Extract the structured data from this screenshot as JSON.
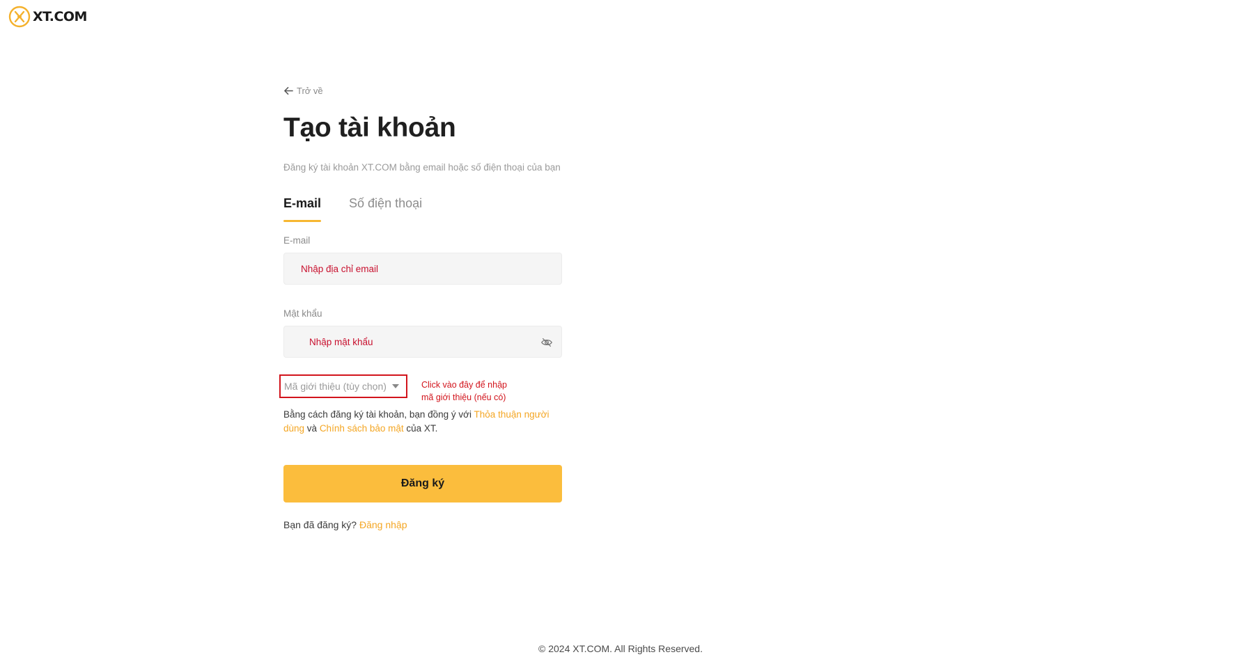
{
  "logo": {
    "text_x": "X",
    "text_rest": "T.COM"
  },
  "back": {
    "label": "Trở về"
  },
  "title": "Tạo tài khoản",
  "subtitle": "Đăng ký tài khoản XT.COM bằng email hoặc số điện thoại của bạn",
  "tabs": [
    {
      "label": "E-mail",
      "active": true
    },
    {
      "label": "Số điện thoại",
      "active": false
    }
  ],
  "form": {
    "email_label": "E-mail",
    "email_placeholder": "Nhập địa chỉ email",
    "password_label": "Mật khẩu",
    "password_placeholder": "Nhập mật khẩu",
    "referral_label": "Mã giới thiệu (tùy chọn)",
    "annotation_line1": "Click vào đây để nhập",
    "annotation_line2": "mã giới thiệu (nếu có)"
  },
  "agreement": {
    "prefix": "Bằng cách đăng ký tài khoản, bạn đồng ý với ",
    "terms_link": "Thỏa thuận người dùng",
    "middle": " và ",
    "privacy_link": "Chính sách bảo mật",
    "suffix": " của XT."
  },
  "submit_label": "Đăng ký",
  "login": {
    "prompt": "Bạn đã đăng ký? ",
    "link": "Đăng nhập"
  },
  "footer": "© 2024 XT.COM. All Rights Reserved.",
  "colors": {
    "accent": "#fbbd3d",
    "link": "#f4a623",
    "annotation": "#d2141c"
  }
}
